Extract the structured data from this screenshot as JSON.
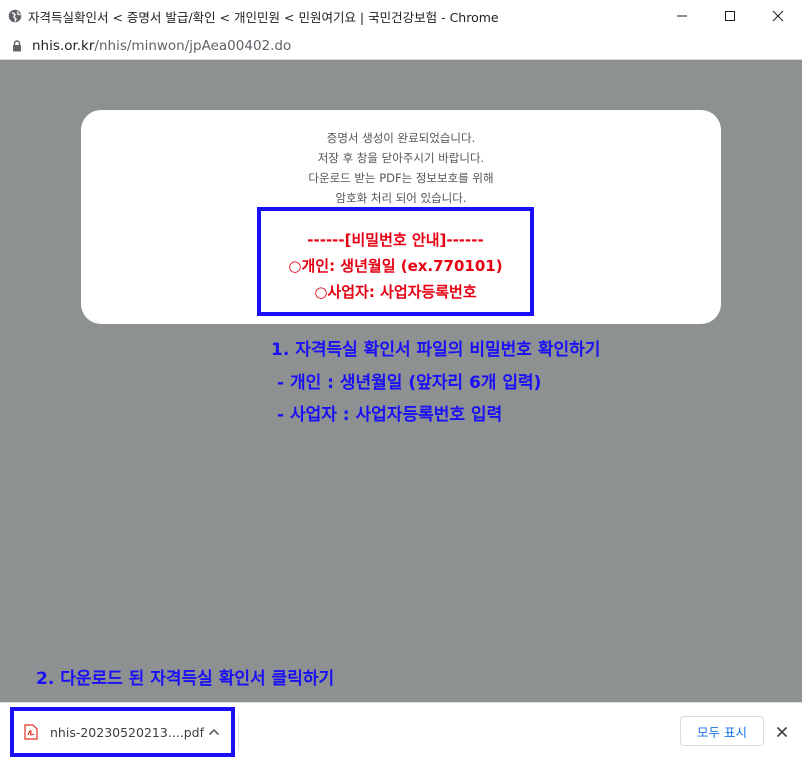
{
  "window": {
    "title": "자격득실확인서 < 증명서 발급/확인 < 개인민원 < 민원여기요 | 국민건강보험 - Chrome",
    "icon": "globe-icon"
  },
  "address": {
    "host": "nhis.or.kr",
    "path": "/nhis/minwon/jpAea00402.do"
  },
  "modal": {
    "lines": [
      "증명서 생성이 완료되었습니다.",
      "저장 후 창을 닫아주시기 바랍니다.",
      "다운로드 받는 PDF는 정보보호를 위해",
      "암호화 처리 되어 있습니다."
    ],
    "password_notice": {
      "header": "------[비밀번호 안내]------",
      "individual": "○개인: 생년월일 (ex.770101)",
      "business": "○사업자: 사업자등록번호"
    }
  },
  "annotations": {
    "step1_title": "1. 자격득실 확인서 파일의 비밀번호 확인하기",
    "step1_individual": "- 개인 : 생년월일 (앞자리 6개 입력)",
    "step1_business": "- 사업자 : 사업자등록번호 입력",
    "step2": "2. 다운로드 된 자격득실 확인서 클릭하기"
  },
  "download_shelf": {
    "file_name": "nhis-20230520213....pdf",
    "show_all_label": "모두 표시"
  },
  "colors": {
    "highlight_blue": "#1a10f5",
    "notice_red": "#e60012",
    "backdrop_gray": "#8e9192"
  }
}
